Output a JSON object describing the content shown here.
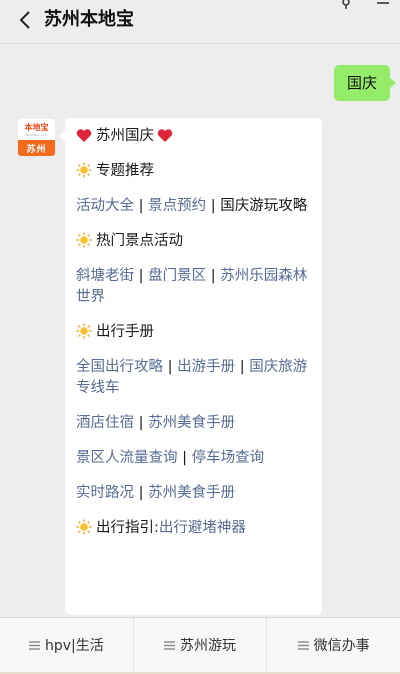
{
  "header": {
    "title": "苏州本地宝",
    "back_icon": "chevron-left-icon"
  },
  "chat": {
    "user_message": "国庆",
    "avatar": {
      "logo_top": "本地宝",
      "logo_sub": "BenDiBao.com",
      "logo_bottom": "苏州"
    },
    "reply": {
      "heading": "苏州国庆",
      "sections": {
        "topics": {
          "title": "专题推荐",
          "links": [
            "活动大全",
            "景点预约"
          ],
          "text": "国庆游玩攻略"
        },
        "hot_spots": {
          "title": "热门景点活动",
          "links": [
            "斜塘老街",
            "盘门景区",
            "苏州乐园森林世界"
          ]
        },
        "travel": {
          "title": "出行手册",
          "links1": [
            "全国出行攻略",
            "出游手册",
            "国庆旅游专线车"
          ],
          "links2": [
            "酒店住宿",
            "苏州美食手册"
          ],
          "links3": [
            "景区人流量查询",
            "停车场查询"
          ],
          "links4": [
            "实时路况",
            "苏州美食手册"
          ]
        },
        "guide": {
          "title": "出行指引:",
          "link": "出行避堵神器"
        }
      },
      "separator": "|"
    }
  },
  "menu": {
    "items": [
      "hpv|生活",
      "苏州游玩",
      "微信办事"
    ]
  },
  "colors": {
    "link": "#576b95",
    "user_bubble": "#95ec69",
    "background": "#ededed",
    "heart": "#e0243a",
    "sun": "#f5a623"
  }
}
